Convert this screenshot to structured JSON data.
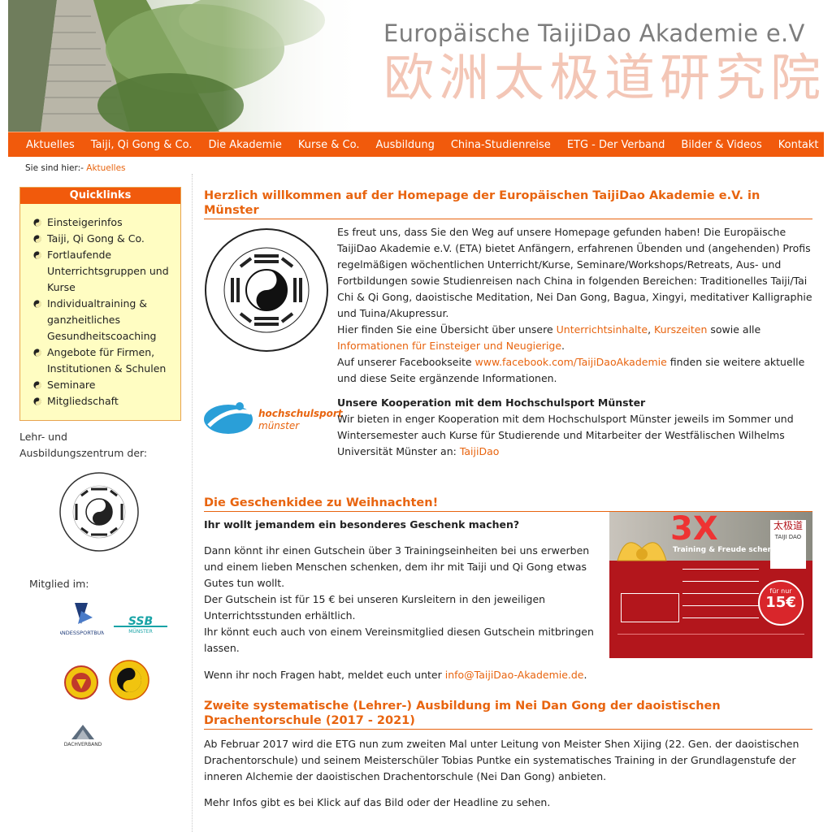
{
  "header": {
    "title": "Europäische TaijiDao Akademie e.V",
    "title_cn": "欧洲太极道研究院"
  },
  "nav": {
    "items": [
      "Aktuelles",
      "Taiji, Qi Gong & Co.",
      "Die Akademie",
      "Kurse & Co.",
      "Ausbildung",
      "China-Studienreise",
      "ETG - Der Verband",
      "Bilder & Videos",
      "Kontakt"
    ]
  },
  "breadcrumb": {
    "prefix": "Sie sind hier:-",
    "current": "Aktuelles"
  },
  "quicklinks": {
    "title": "Quicklinks",
    "items": [
      "Einsteigerinfos",
      "Taiji, Qi Gong & Co.",
      "Fortlaufende Unterrichtsgruppen und Kurse",
      "Individualtraining & ganzheitliches Gesundheitscoaching",
      "Angebote für Firmen, Institutionen & Schulen",
      "Seminare",
      "Mitgliedschaft"
    ]
  },
  "sidebar": {
    "center_label": "Lehr- und Ausbildungszentrum der:",
    "member_label": "Mitglied im:"
  },
  "intro": {
    "headline": "Herzlich willkommen auf der Homepage der Europäischen TaijiDao Akademie e.V. in Münster",
    "p1": "Es freut uns, dass Sie den Weg auf unsere Homepage gefunden haben! Die Europäische TaijiDao Akademie e.V. (ETA) bietet Anfängern, erfahrenen Übenden und (angehenden) Profis regelmäßigen wöchentlichen Unterricht/Kurse, Seminare/Workshops/Retreats, Aus- und Fortbildungen sowie Studienreisen nach China in folgenden Bereichen:  Traditionelles Taiji/Tai Chi & Qi Gong, daoistische Meditation, Nei Dan Gong, Bagua, Xingyi, meditativer Kalligraphie und Tuina/Akupressur.",
    "p2_a": "Hier finden Sie eine Übersicht über unsere ",
    "p2_link1": "Unterrichtsinhalte",
    "p2_b": ", ",
    "p2_link2": "Kurszeiten",
    "p2_c": " sowie alle ",
    "p2_link3": "Informationen für Einsteiger und Neugierige",
    "p2_d": ".",
    "p3_a": "Auf unserer Facebookseite ",
    "p3_link": "www.facebook.com/TaijiDaoAkademie",
    "p3_b": " finden sie weitere aktuelle und diese Seite ergänzende Informationen."
  },
  "coop": {
    "logo_text1": "hochschulsport",
    "logo_text2": "münster",
    "title": "Unsere Kooperation mit dem Hochschulsport Münster",
    "text": "Wir bieten in enger Kooperation mit dem Hochschulsport Münster jeweils im Sommer und Wintersemester auch Kurse für Studierende und Mitarbeiter der Westfälischen Wilhelms Universität Münster an: ",
    "link": "TaijiDao"
  },
  "gift": {
    "headline": "Die Geschenkidee zu Weihnachten!",
    "question": "Ihr wollt jemandem ein besonderes Geschenk machen?",
    "p1": "Dann könnt ihr einen Gutschein über 3 Trainingseinheiten bei uns erwerben und einem lieben Menschen schenken, dem ihr mit Taiji und Qi Gong etwas Gutes tun wollt.",
    "p2": "Der Gutschein ist für 15 € bei unseren Kursleitern in den jeweiligen Unterrichtsstunden erhältlich.",
    "p3": "Ihr könnt euch auch von einem Vereinsmitglied diesen Gutschein mitbringen lassen.",
    "contact_a": "Wenn ihr noch Fragen habt, meldet euch unter ",
    "contact_link": "info@TaijiDao-Akademie.de",
    "contact_b": ".",
    "voucher": {
      "big": "3X",
      "subtitle": "Training & Freude schenken",
      "cn": "太极道",
      "brand": "TAIJI DAO",
      "price_top": "für nur",
      "price": "15€"
    }
  },
  "training": {
    "headline": "Zweite systematische (Lehrer-) Ausbildung im Nei Dan Gong der daoistischen Drachentorschule (2017 - 2021)",
    "p1": "Ab Februar 2017 wird die ETG nun zum zweiten Mal unter Leitung von Meister Shen Xijing (22. Gen. der daoistischen Drachentorschule) und seinem Meisterschüler Tobias Puntke ein systematisches Training in der Grundlagenstufe der inneren Alchemie der daoistischen Drachentorschule (Nei Dan Gong) anbieten.",
    "p2": "Mehr Infos gibt es bei Klick auf das Bild oder der Headline zu sehen."
  },
  "colors": {
    "accent": "#e8640f",
    "nav_bg": "#f15a0c",
    "quicklinks_bg": "#fffdc2"
  }
}
